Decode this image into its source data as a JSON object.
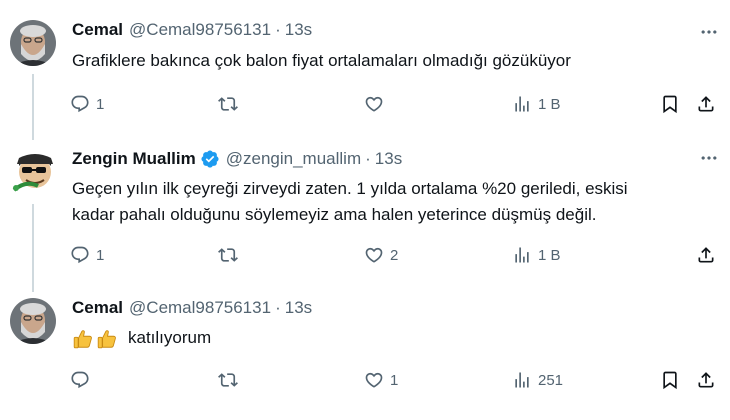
{
  "tweets": [
    {
      "name": "Cemal",
      "handle": "@Cemal98756131",
      "separator": "·",
      "time": "13s",
      "text_lines": [
        "Grafiklere bakınca çok balon fiyat ortalamaları olmadığı gözüküyor"
      ],
      "reply_count": "1",
      "retweet_count": "",
      "like_count": "",
      "view_count": "1 B"
    },
    {
      "name": "Zengin Muallim",
      "handle": "@zengin_muallim",
      "separator": "·",
      "time": "13s",
      "text_lines": [
        "Geçen yılın ilk çeyreği zirveydi zaten. 1 yılda ortalama %20 geriledi, eskisi",
        "kadar pahalı olduğunu söylemeyiz ama halen yeterince düşmüş değil."
      ],
      "reply_count": "1",
      "retweet_count": "",
      "like_count": "2",
      "view_count": "1 B"
    },
    {
      "name": "Cemal",
      "handle": "@Cemal98756131",
      "separator": "·",
      "time": "13s",
      "text_lines": [
        "katılıyorum"
      ],
      "reply_count": "",
      "retweet_count": "",
      "like_count": "1",
      "view_count": "251"
    }
  ],
  "icons": {
    "reply": "reply-icon",
    "retweet": "retweet-icon",
    "like": "heart-icon",
    "views": "views-icon",
    "bookmark": "bookmark-icon",
    "share": "share-icon",
    "more": "more-icon",
    "verified": "verified-badge-icon",
    "emoji": "thumbs-up-emoji"
  },
  "colors": {
    "text": "#0f1419",
    "secondary": "#536471",
    "verified": "#1d9bf0",
    "thread_line": "#cfd9de"
  }
}
